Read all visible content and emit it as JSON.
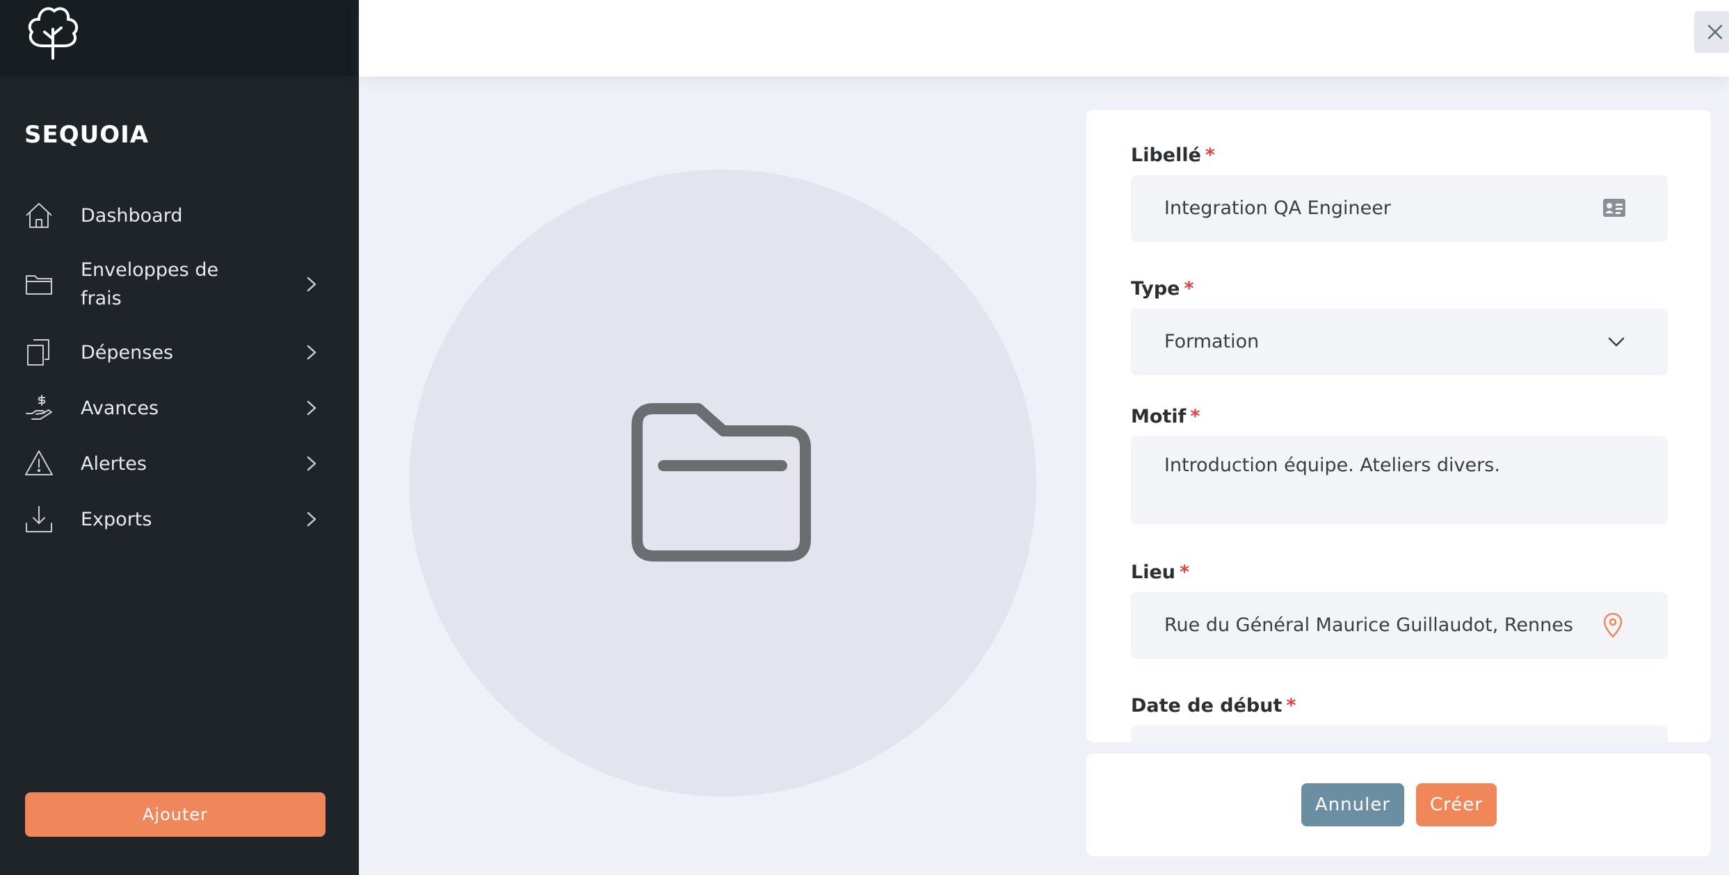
{
  "app": {
    "brand": "SEQUOIA"
  },
  "sidebar": {
    "items": [
      {
        "label": "Dashboard",
        "icon": "home-icon",
        "has_children": false
      },
      {
        "label": "Enveloppes de frais",
        "icon": "folder-icon",
        "has_children": true
      },
      {
        "label": "Dépenses",
        "icon": "documents-icon",
        "has_children": true
      },
      {
        "label": "Avances",
        "icon": "hand-dollar-icon",
        "has_children": true
      },
      {
        "label": "Alertes",
        "icon": "warning-icon",
        "has_children": true
      },
      {
        "label": "Exports",
        "icon": "download-icon",
        "has_children": true
      }
    ],
    "add_button": "Ajouter"
  },
  "form": {
    "libelle": {
      "label": "Libellé",
      "required": "*",
      "value": "Integration QA Engineer",
      "icon": "id-card-icon"
    },
    "type": {
      "label": "Type",
      "required": "*",
      "value": "Formation",
      "icon": "chevron-down-icon"
    },
    "motif": {
      "label": "Motif",
      "required": "*",
      "value": "Introduction équipe. Ateliers divers."
    },
    "lieu": {
      "label": "Lieu",
      "required": "*",
      "value": "Rue du Général Maurice Guillaudot, Rennes",
      "icon": "map-pin-icon"
    },
    "date_debut": {
      "label": "Date de début",
      "required": "*",
      "value": ""
    }
  },
  "actions": {
    "cancel": "Annuler",
    "create": "Créer"
  },
  "colors": {
    "sidebar_bg": "#1e2428",
    "accent": "#f0875a",
    "cancel": "#6b8ea3",
    "required": "#e0433f",
    "page_bg": "#f0f0f8"
  }
}
